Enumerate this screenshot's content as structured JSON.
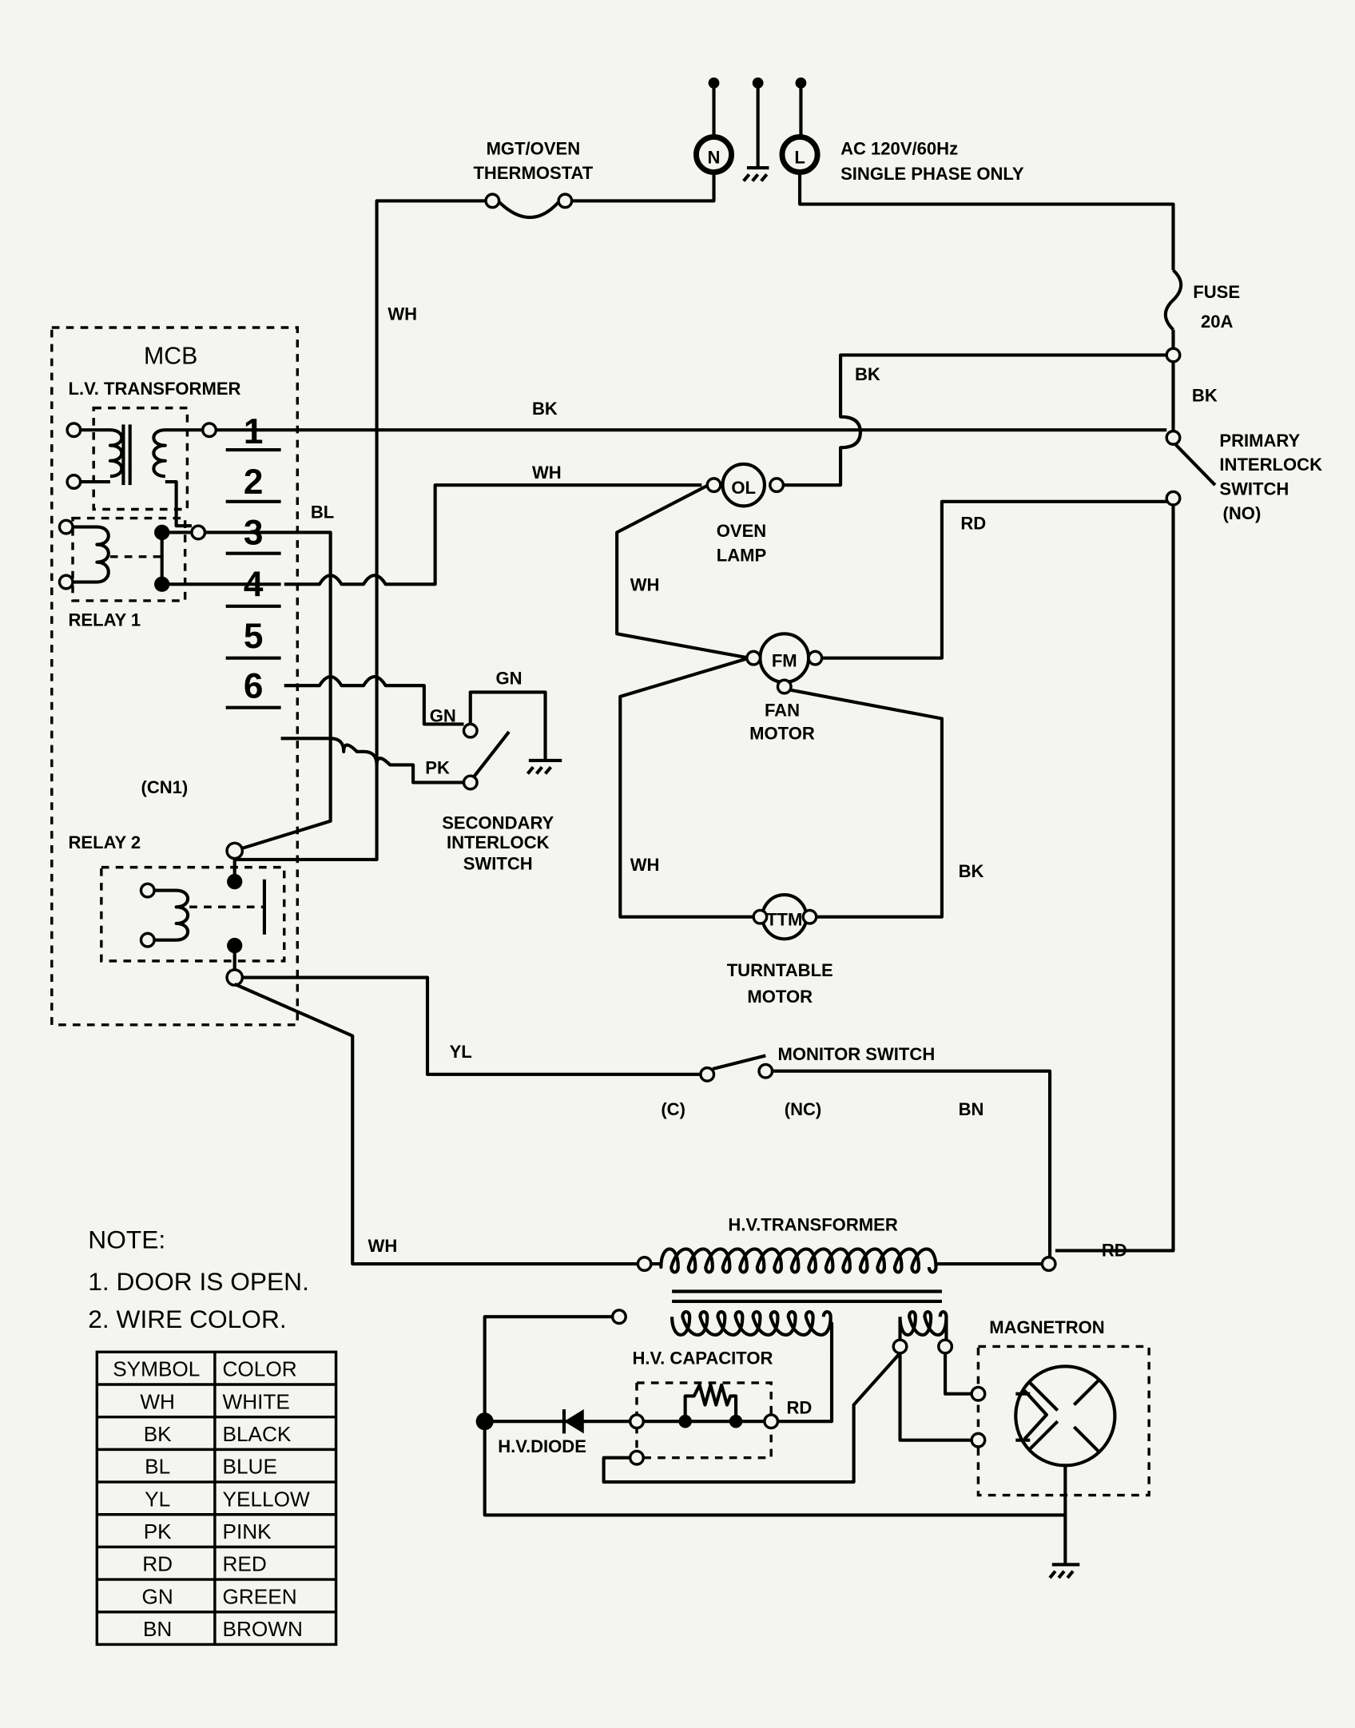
{
  "supply": {
    "neutral": "N",
    "line": "L",
    "spec_line1": "AC 120V/60Hz",
    "spec_line2": "SINGLE PHASE ONLY"
  },
  "thermostat": {
    "line1": "MGT/OVEN",
    "line2": "THERMOSTAT"
  },
  "fuse": {
    "label": "FUSE",
    "rating": "20A"
  },
  "mcb": {
    "title": "MCB",
    "lv_transformer": "L.V. TRANSFORMER",
    "relay1": "RELAY 1",
    "relay2": "RELAY 2",
    "connector": "(CN1)",
    "pins": [
      "1",
      "2",
      "3",
      "4",
      "5",
      "6"
    ]
  },
  "primary_switch": {
    "line1": "PRIMARY",
    "line2": "INTERLOCK",
    "line3": "SWITCH",
    "line4": "(NO)"
  },
  "secondary_switch": {
    "line1": "SECONDARY",
    "line2": "INTERLOCK",
    "line3": "SWITCH"
  },
  "oven_lamp": {
    "symbol": "OL",
    "line1": "OVEN",
    "line2": "LAMP"
  },
  "fan_motor": {
    "symbol": "FM",
    "line1": "FAN",
    "line2": "MOTOR"
  },
  "turntable_motor": {
    "symbol": "TTM",
    "line1": "TURNTABLE",
    "line2": "MOTOR"
  },
  "monitor_switch": {
    "label": "MONITOR SWITCH",
    "c": "(C)",
    "nc": "(NC)"
  },
  "hv": {
    "transformer": "H.V.TRANSFORMER",
    "capacitor": "H.V. CAPACITOR",
    "diode": "H.V.DIODE",
    "magnetron": "MAGNETRON"
  },
  "wires": {
    "wh_top": "WH",
    "bk_line1": "BK",
    "wh_lamp": "WH",
    "bl": "BL",
    "bk_fuse": "BK",
    "bk_fuse2": "BK",
    "rd_fan": "RD",
    "wh_lamp_fan": "WH",
    "wh_fan_ttm": "WH",
    "bk_ttm": "BK",
    "gn1": "GN",
    "gn2": "GN",
    "pk": "PK",
    "yl": "YL",
    "bn": "BN",
    "wh_hv": "WH",
    "rd_hv": "RD",
    "rd_cap": "RD"
  },
  "notes": {
    "title": "NOTE:",
    "items": [
      "1. DOOR IS OPEN.",
      "2. WIRE COLOR."
    ]
  },
  "color_table": {
    "headers": [
      "SYMBOL",
      "COLOR"
    ],
    "rows": [
      [
        "WH",
        "WHITE"
      ],
      [
        "BK",
        "BLACK"
      ],
      [
        "BL",
        "BLUE"
      ],
      [
        "YL",
        "YELLOW"
      ],
      [
        "PK",
        "PINK"
      ],
      [
        "RD",
        "RED"
      ],
      [
        "GN",
        "GREEN"
      ],
      [
        "BN",
        "BROWN"
      ]
    ]
  }
}
